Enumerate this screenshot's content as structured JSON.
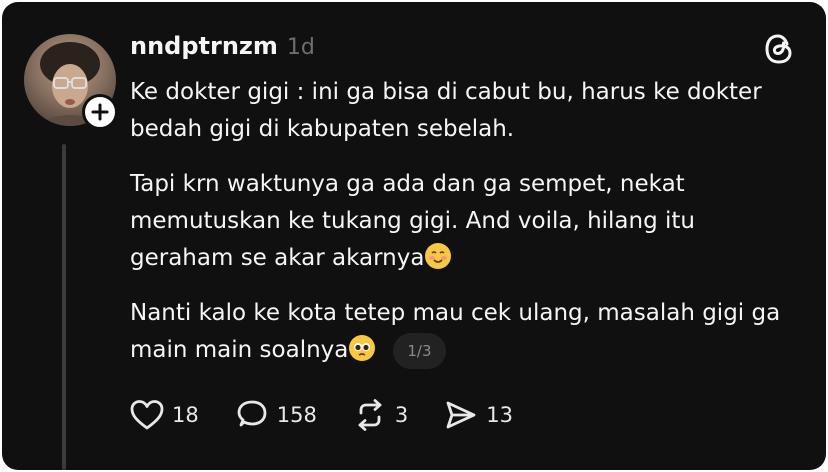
{
  "post": {
    "username": "nndptrnzm",
    "time_ago": "1d",
    "paragraphs": [
      "Ke dokter gigi : ini ga bisa di cabut bu, harus ke dokter bedah gigi di kabupaten sebelah.",
      "Tapi krn waktunya ga ada dan ga sempet, nekat memutuskan ke tukang gigi. And voila, hilang itu geraham se akar akarnya",
      "Nanti kalo ke kota tetep mau cek ulang, masalah gigi ga main main soalnya"
    ],
    "page_indicator": "1/3"
  },
  "actions": {
    "like_count": "18",
    "reply_count": "158",
    "repost_count": "3",
    "share_count": "13"
  },
  "icons": {
    "like": "heart-icon",
    "reply": "speech-bubble-icon",
    "repost": "repost-icon",
    "share": "send-icon",
    "follow": "plus-icon",
    "logo": "threads-logo-icon"
  },
  "colors": {
    "background": "#101010",
    "text": "#f3f5f7",
    "muted": "#6e6e6e"
  }
}
